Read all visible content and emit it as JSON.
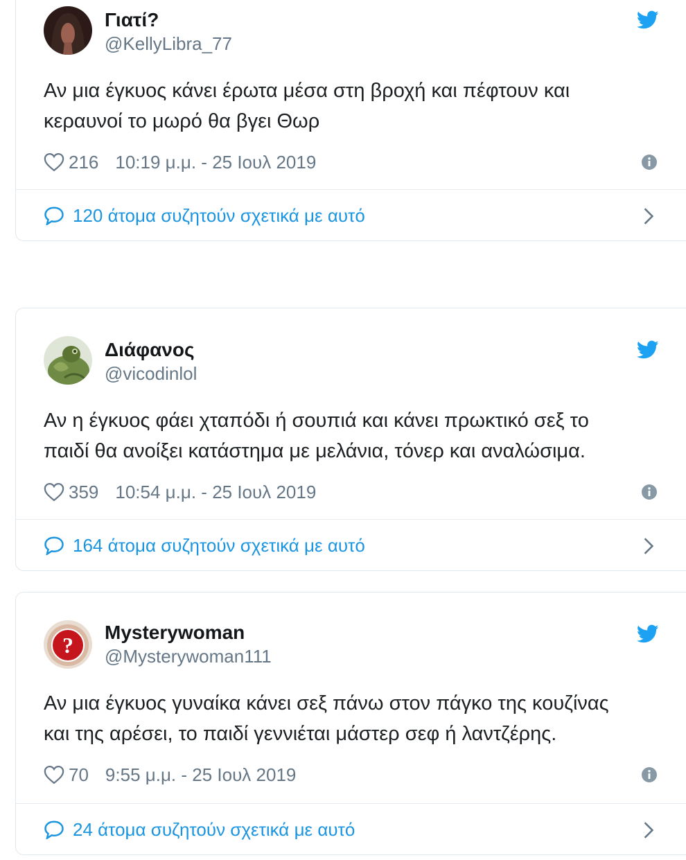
{
  "tweets": [
    {
      "display_name": "Γιατί?",
      "handle": "@KellyLibra_77",
      "text_line1": "Αν μια έγκυος κάνει έρωτα μέσα στη βροχή και πέφτουν και",
      "text_line2": "κεραυνοί το μωρό θα βγει Θωρ",
      "likes": "216",
      "timestamp": "10:19 μ.μ. - 25 Ιουλ 2019",
      "conversation": "120 άτομα συζητούν σχετικά με αυτό"
    },
    {
      "display_name": "Διάφανος",
      "handle": "@vicodinlol",
      "text_line1": "Αν η έγκυος φάει χταπόδι ή σουπιά και κάνει πρωκτικό σεξ το",
      "text_line2": "παιδί θα ανοίξει κατάστημα με μελάνια, τόνερ και αναλώσιμα.",
      "likes": "359",
      "timestamp": "10:54 μ.μ. - 25 Ιουλ 2019",
      "conversation": "164 άτομα συζητούν σχετικά με αυτό"
    },
    {
      "display_name": "Mysterywoman",
      "handle": "@Mysterywoman111",
      "text_line1": "Αν μια έγκυος γυναίκα κάνει σεξ πάνω στον πάγκο της κουζίνας",
      "text_line2": "και της αρέσει, το παιδί γεννιέται μάστερ σεφ ή λαντζέρης.",
      "likes": "70",
      "timestamp": "9:55 μ.μ. - 25 Ιουλ 2019",
      "conversation": "24 άτομα συζητούν σχετικά με αυτό"
    }
  ],
  "icons": {
    "like": "heart-icon",
    "info": "info-icon",
    "brand": "twitter-bird-icon",
    "conversation": "speech-bubble-icon",
    "chevron": "chevron-right-icon"
  },
  "colors": {
    "twitter_blue": "#1da1f2",
    "link_blue": "#1b95e0",
    "meta_gray": "#657786",
    "border": "#e1e8ed"
  }
}
